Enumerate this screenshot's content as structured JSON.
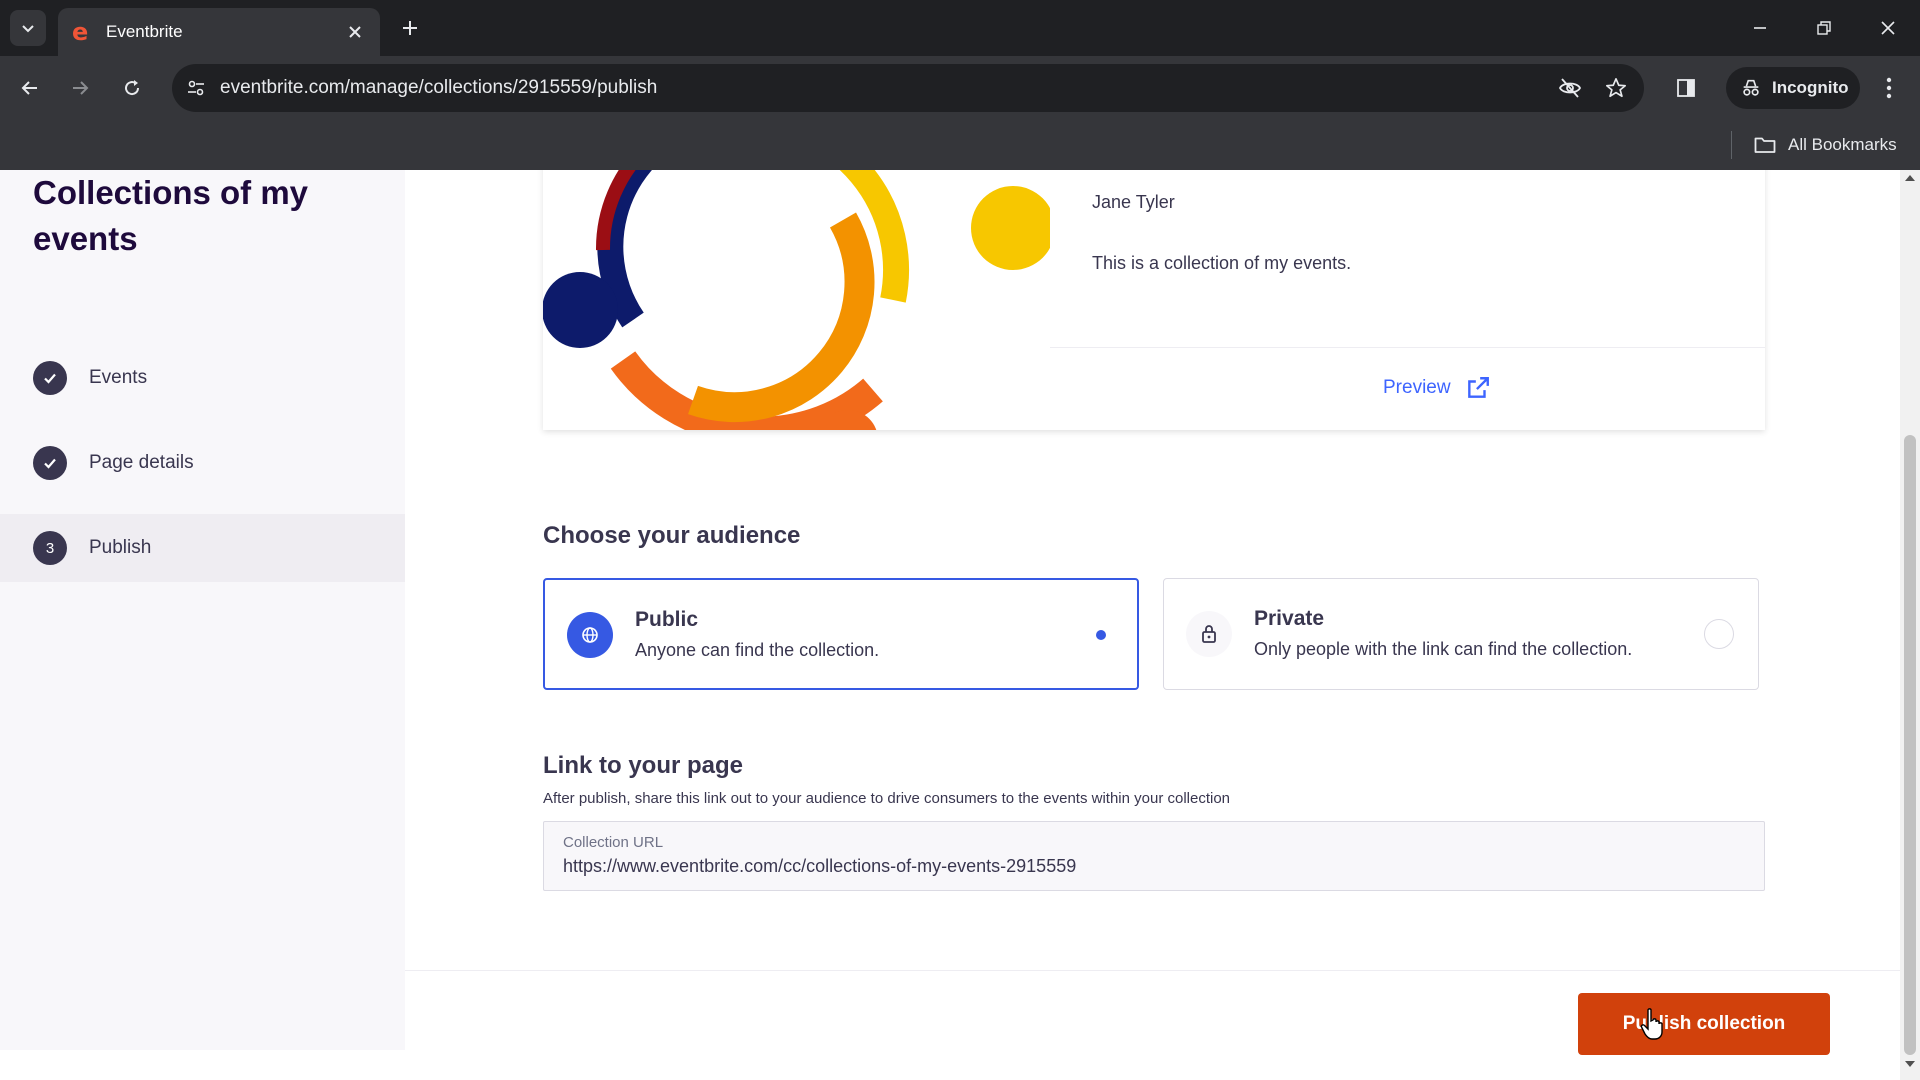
{
  "browser": {
    "tab_title": "Eventbrite",
    "tab_favicon": "e",
    "url": "eventbrite.com/manage/collections/2915559/publish",
    "incognito_label": "Incognito",
    "bookmarks_label": "All Bookmarks"
  },
  "sidebar": {
    "title": "Collections of my events",
    "steps": [
      {
        "label": "Events",
        "state": "complete"
      },
      {
        "label": "Page details",
        "state": "complete"
      },
      {
        "label": "Publish",
        "state": "current",
        "number": "3"
      }
    ]
  },
  "collection_card": {
    "organizer": "Jane Tyler",
    "summary": "This is a collection of my events.",
    "preview_label": "Preview"
  },
  "audience": {
    "heading": "Choose your audience",
    "options": [
      {
        "title": "Public",
        "description": "Anyone can find the collection.",
        "icon": "globe-icon",
        "selected": true
      },
      {
        "title": "Private",
        "description": "Only people with the link can find the collection.",
        "icon": "lock-icon",
        "selected": false
      }
    ]
  },
  "link": {
    "heading": "Link to your page",
    "description": "After publish, share this link out to your audience to drive consumers to the events within your collection",
    "field_label": "Collection URL",
    "field_value": "https://www.eventbrite.com/cc/collections-of-my-events-2915559"
  },
  "footer": {
    "publish_label": "Publish collection"
  },
  "colors": {
    "brand_orange": "#d1410c",
    "accent_blue": "#3659e3",
    "text_dark": "#39364f"
  }
}
